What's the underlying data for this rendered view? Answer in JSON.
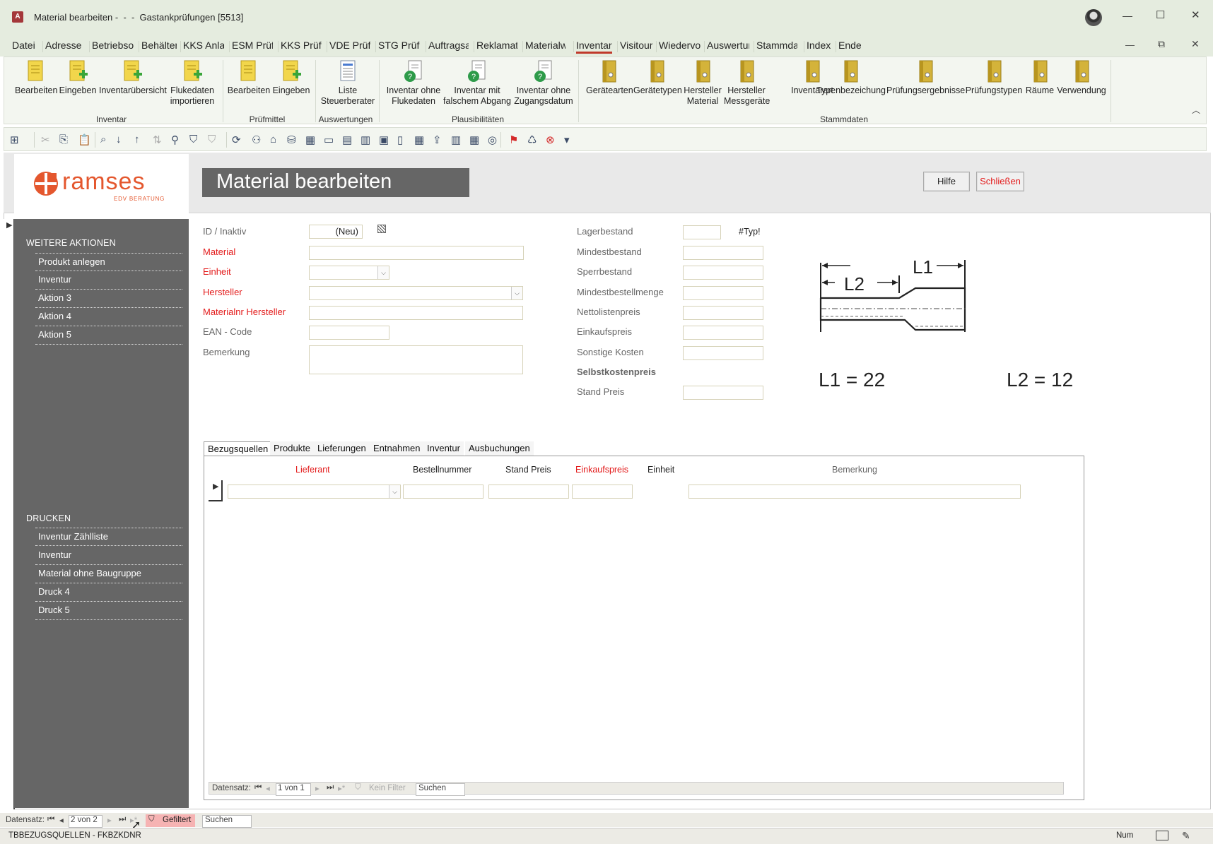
{
  "window": {
    "title": "Material bearbeiten -  -  -  Gastankprüfungen [5513]",
    "controls": {
      "minimize": "—",
      "maximize": "☐",
      "close": "✕"
    },
    "inner_controls": {
      "minimize": "—",
      "restore": "⧉",
      "close": "✕"
    }
  },
  "menu": [
    "Datei",
    "Adressen",
    "Betriebsor",
    "Behälter",
    "KKS Anlag",
    "ESM Prüfu",
    "KKS Prüfur",
    "VDE Prüfur",
    "STG Prüfur",
    "Auftragsat",
    "Reklamatic",
    "Materialwi",
    "Inventar",
    "Visitour",
    "Wiedervor",
    "Auswertun",
    "Stammdat",
    "Index",
    "Ende"
  ],
  "menu_active": "Inventar",
  "ribbon": {
    "groups": {
      "inventar": {
        "title": "Inventar",
        "buttons": [
          "Bearbeiten",
          "Eingeben",
          "Inventarübersicht",
          "Flukedaten importieren"
        ]
      },
      "pruefmittel": {
        "title": "Prüfmittel",
        "buttons": [
          "Bearbeiten",
          "Eingeben"
        ]
      },
      "auswertungen": {
        "title": "Auswertungen",
        "buttons": [
          "Liste Steuerberater"
        ]
      },
      "plausibilitaeten": {
        "title": "Plausibilitäten",
        "buttons": [
          "Inventar ohne Flukedaten",
          "Inventar mit falschem Abgang",
          "Inventar ohne Zugangsdatum"
        ]
      },
      "stammdaten": {
        "title": "Stammdaten",
        "buttons": [
          "Gerätearten",
          "Gerätetypen",
          "Hersteller Material",
          "Hersteller Messgeräte",
          "Inventarart",
          "Typenbezeichung",
          "Prüfungsergebnisse",
          "Prüfungstypen",
          "Räume",
          "Verwendung"
        ]
      }
    },
    "collapse_icon": "chevron-up"
  },
  "logo": {
    "brand": "ramses",
    "tagline": "EDV BERATUNG"
  },
  "form": {
    "title": "Material bearbeiten",
    "help_button": "Hilfe",
    "close_button": "Schließen"
  },
  "sidebar": {
    "weitere_title": "WEITERE AKTIONEN",
    "weitere": [
      "Produkt anlegen",
      "Inventur",
      "Aktion 3",
      "Aktion 4",
      "Aktion 5"
    ],
    "drucken_title": "DRUCKEN",
    "drucken": [
      "Inventur Zählliste",
      "Inventur",
      "Material ohne Baugruppe",
      "Druck 4",
      "Druck 5"
    ]
  },
  "fields_left": {
    "id_label": "ID / Inaktiv",
    "id_value": "(Neu)",
    "material": "Material",
    "einheit": "Einheit",
    "hersteller": "Hersteller",
    "materialnr": "Materialnr Hersteller",
    "ean": "EAN - Code",
    "bemerkung": "Bemerkung"
  },
  "fields_right": {
    "lagerbestand": "Lagerbestand",
    "typ": "#Typ!",
    "mindestbestand": "Mindestbestand",
    "sperrbestand": "Sperrbestand",
    "mindestbestellmenge": "Mindestbestellmenge",
    "nettolistenpreis": "Nettolistenpreis",
    "einkaufspreis": "Einkaufspreis",
    "sonstige": "Sonstige Kosten",
    "selbstkosten": "Selbstkostenpreis",
    "standpreis": "Stand Preis"
  },
  "drawing": {
    "l1": "L1",
    "l2": "L2",
    "l1_value": "L1 = 22",
    "l2_value": "L2 = 12"
  },
  "tabs": [
    "Bezugsquellen",
    "Produkte",
    "Lieferungen",
    "Entnahmen",
    "Inventur",
    "Ausbuchungen"
  ],
  "tab_active": "Bezugsquellen",
  "subform": {
    "columns": [
      "Lieferant",
      "Bestellnummer",
      "Stand Preis",
      "Einkaufspreis",
      "Einheit",
      "Bemerkung"
    ],
    "nav_label": "Datensatz:",
    "nav_position": "1 von 1",
    "nav_filter": "Kein Filter",
    "nav_search": "Suchen"
  },
  "main_nav": {
    "label": "Datensatz:",
    "position": "2 von 2",
    "filter": "Gefiltert",
    "search": "Suchen"
  },
  "status": {
    "left": "TBBEZUGSQUELLEN - FKBZKDNR",
    "num": "Num"
  }
}
